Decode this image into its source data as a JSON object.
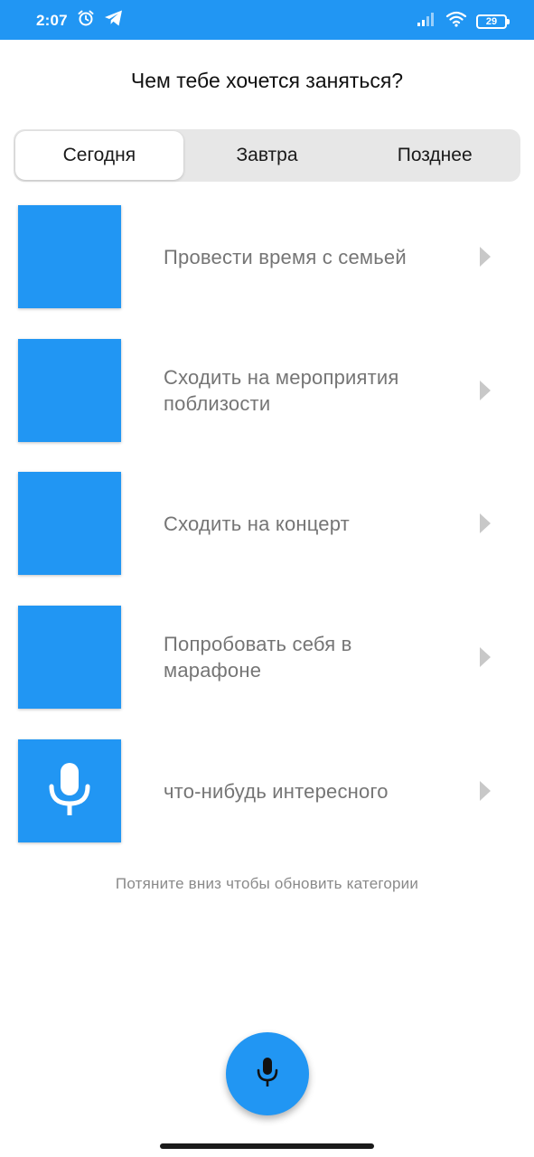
{
  "status_bar": {
    "time": "2:07",
    "battery": "29",
    "icons": [
      "alarm-icon",
      "telegram-icon",
      "signal-icon",
      "wifi-icon",
      "battery-icon"
    ],
    "color": "#2196f3"
  },
  "header": {
    "title": "Чем тебе хочется заняться?"
  },
  "tabs": [
    {
      "label": "Сегодня",
      "active": true
    },
    {
      "label": "Завтра",
      "active": false
    },
    {
      "label": "Позднее",
      "active": false
    }
  ],
  "items": [
    {
      "label": "Провести время с семьей",
      "icon": ""
    },
    {
      "label": "Сходить на мероприятия поблизости",
      "icon": ""
    },
    {
      "label": "Сходить на концерт",
      "icon": ""
    },
    {
      "label": "Попробовать себя в марафоне",
      "icon": ""
    },
    {
      "label": "что-нибудь интересного",
      "icon": "microphone-icon"
    }
  ],
  "hint": "Потяните вниз чтобы обновить категории",
  "fab": {
    "icon": "microphone-icon"
  },
  "colors": {
    "accent": "#2196f3",
    "item_text": "#757575",
    "chevron": "#c8c8c8"
  }
}
